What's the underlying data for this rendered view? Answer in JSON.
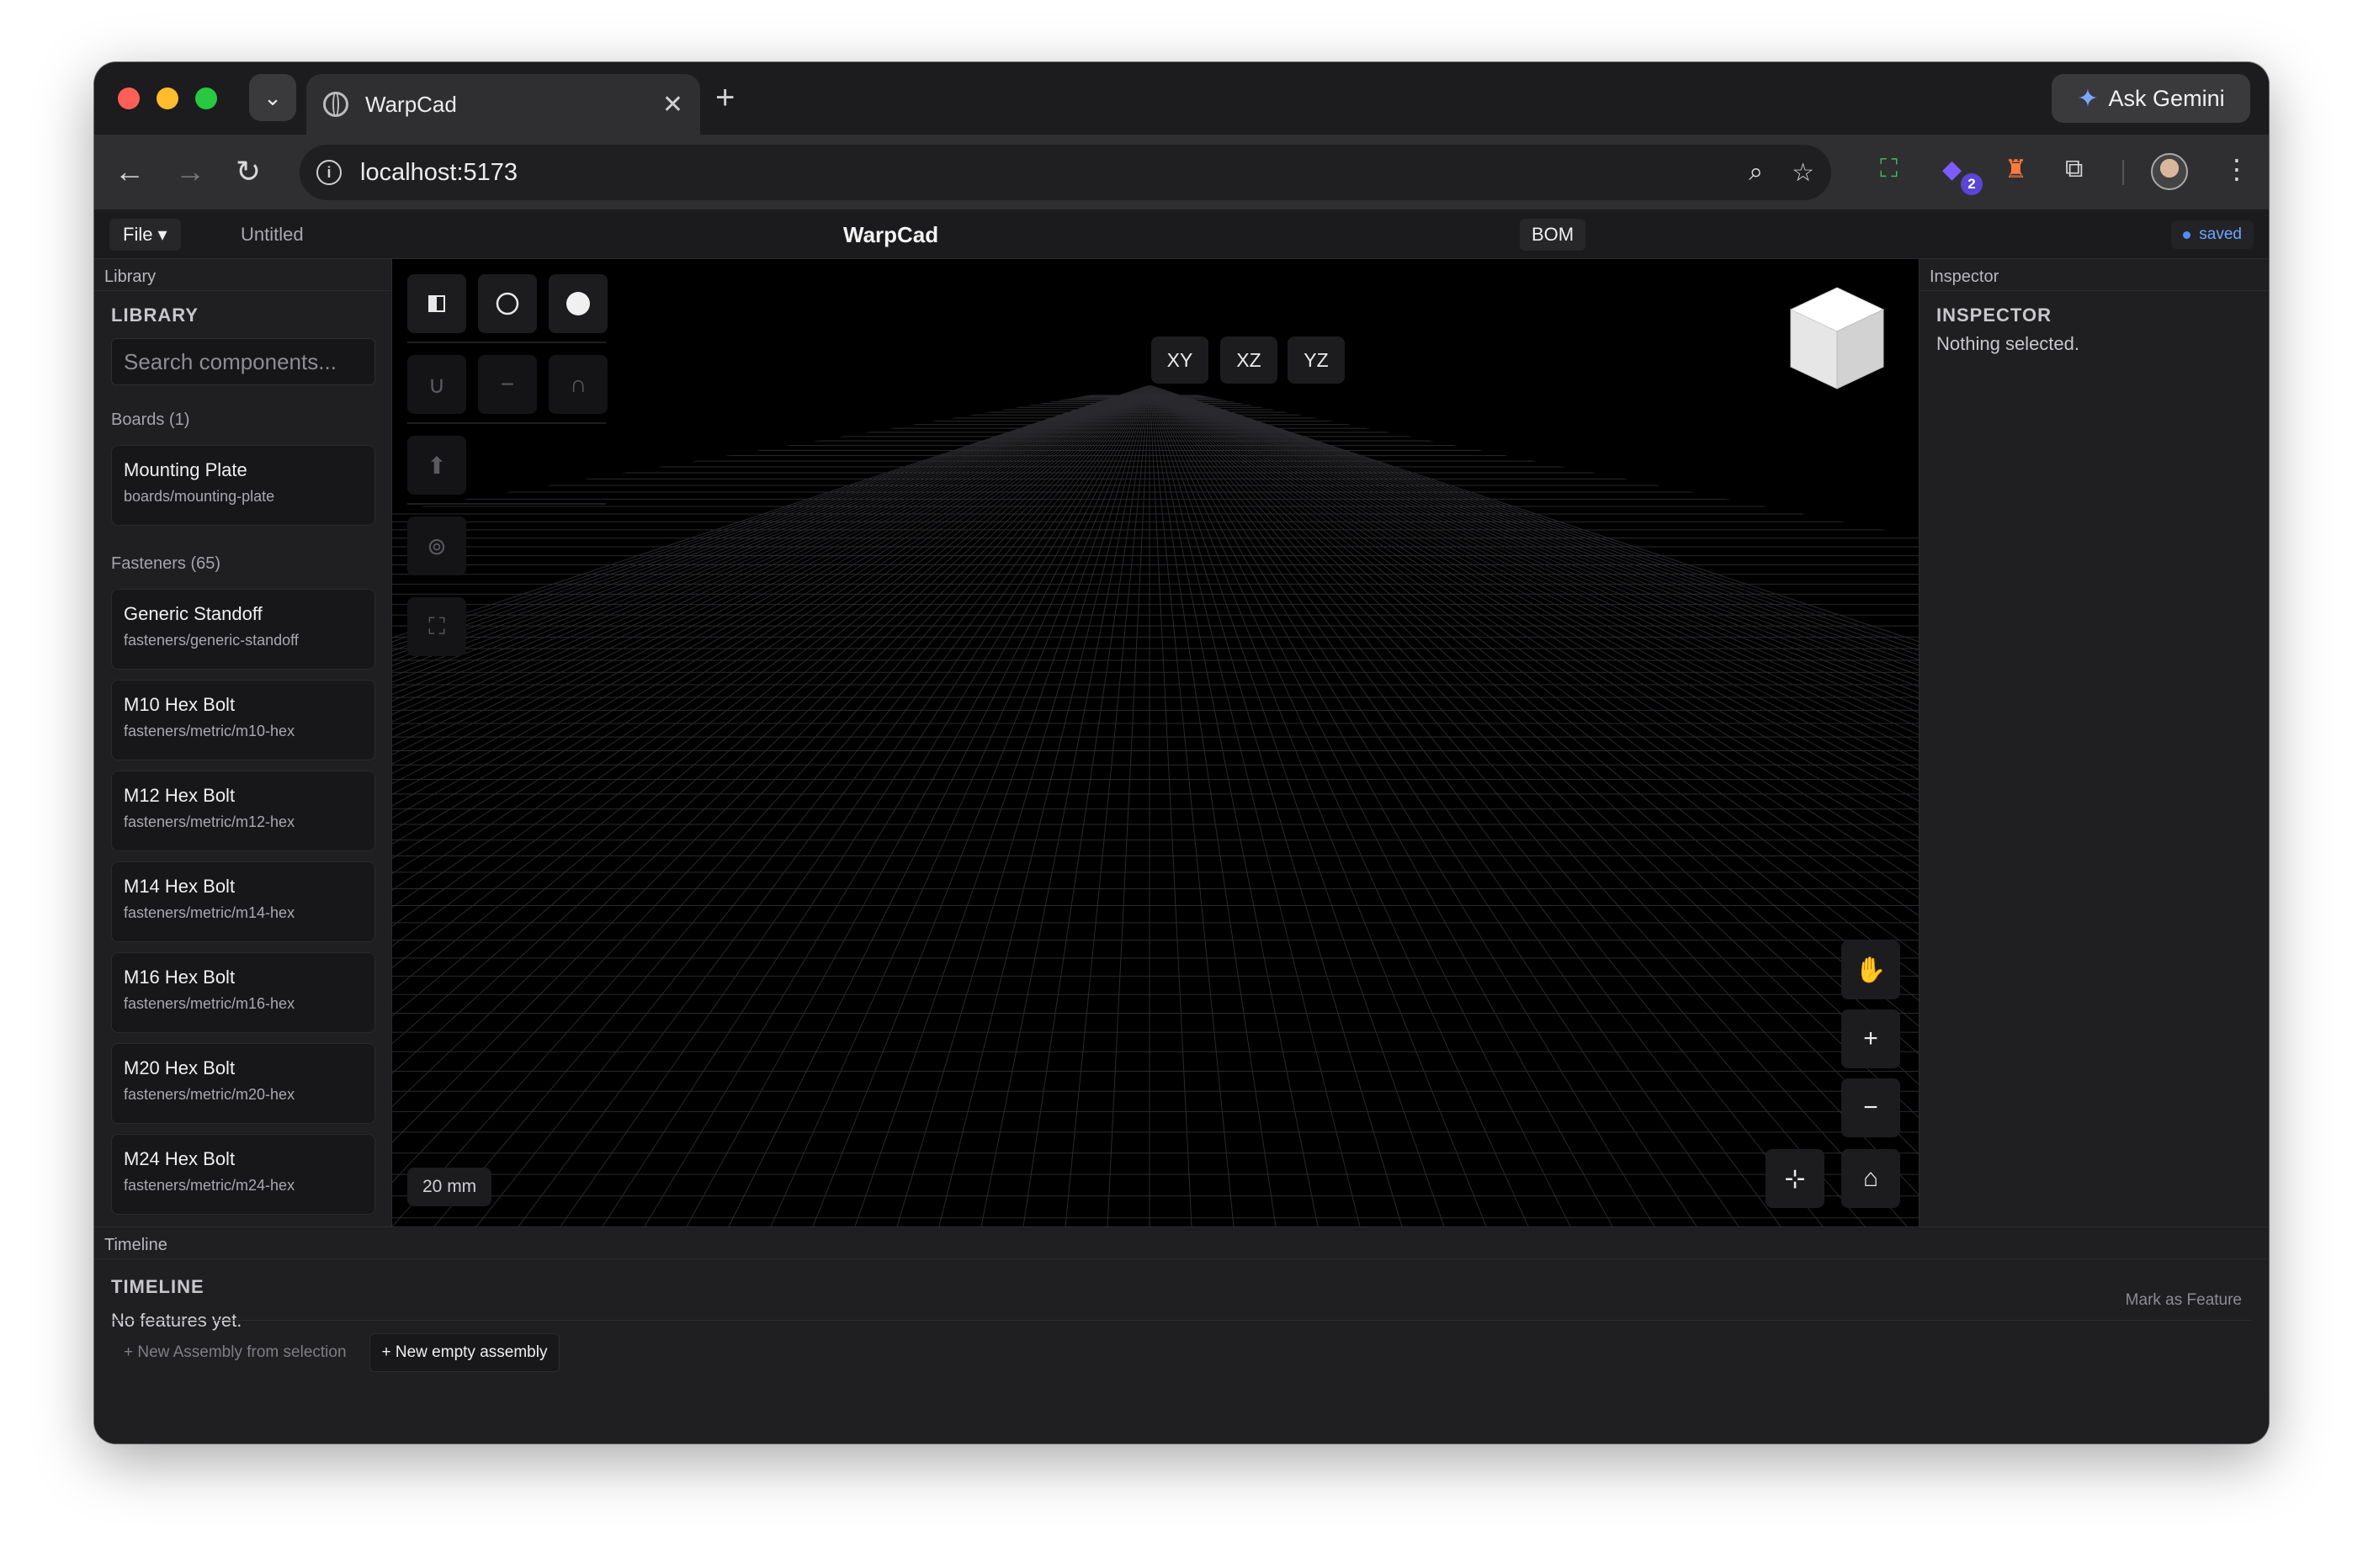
{
  "browser": {
    "tab_title": "WarpCad",
    "url": "localhost:5173",
    "gemini_label": "Ask Gemini",
    "extension_badge": "2"
  },
  "app": {
    "file_menu": "File ▾",
    "doc_title": "Untitled",
    "title": "WarpCad",
    "bom_label": "BOM",
    "save_status": "saved"
  },
  "library": {
    "panel_tab": "Library",
    "heading": "LIBRARY",
    "search_placeholder": "Search components...",
    "groups": [
      {
        "label": "Boards (1)",
        "items": [
          {
            "name": "Mounting Plate",
            "path": "boards/mounting-plate"
          }
        ]
      },
      {
        "label": "Fasteners (65)",
        "items": [
          {
            "name": "Generic Standoff",
            "path": "fasteners/generic-standoff"
          },
          {
            "name": "M10 Hex Bolt",
            "path": "fasteners/metric/m10-hex"
          },
          {
            "name": "M12 Hex Bolt",
            "path": "fasteners/metric/m12-hex"
          },
          {
            "name": "M14 Hex Bolt",
            "path": "fasteners/metric/m14-hex"
          },
          {
            "name": "M16 Hex Bolt",
            "path": "fasteners/metric/m16-hex"
          },
          {
            "name": "M20 Hex Bolt",
            "path": "fasteners/metric/m20-hex"
          },
          {
            "name": "M24 Hex Bolt",
            "path": "fasteners/metric/m24-hex"
          }
        ]
      }
    ]
  },
  "viewport": {
    "views": [
      "XY",
      "XZ",
      "YZ"
    ],
    "scale_label": "20 mm",
    "tools": {
      "row1": [
        "panel-toggle-icon",
        "circle-outline-icon",
        "circle-filled-icon"
      ],
      "row2": [
        "∪",
        "−",
        "∩"
      ],
      "extrude": "⬆",
      "link": "⊚",
      "frame": "⛶"
    },
    "nav": {
      "pan": "✋",
      "zoom_in": "+",
      "zoom_out": "−",
      "center": "⊹",
      "home": "⌂"
    }
  },
  "inspector": {
    "panel_tab": "Inspector",
    "heading": "INSPECTOR",
    "empty": "Nothing selected."
  },
  "timeline": {
    "panel_tab": "Timeline",
    "heading": "TIMELINE",
    "empty": "No features yet.",
    "mark_feature": "Mark as Feature",
    "new_from_selection": "+ New Assembly from selection",
    "new_empty": "+ New empty assembly"
  }
}
